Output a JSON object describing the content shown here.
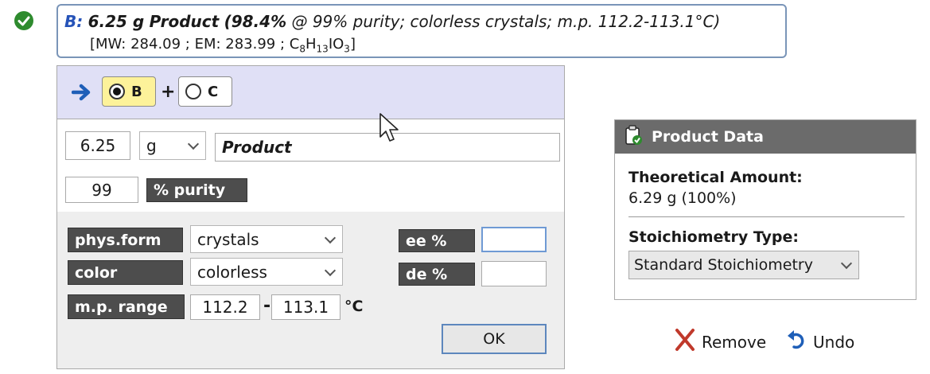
{
  "summary": {
    "tag": "B:",
    "amount": "6.25 g",
    "name": "Product",
    "yield": "(98.4%",
    "details": "@ 99% purity; colorless crystals; m.p. 112.2-113.1°C)",
    "mw_line": "[MW: 284.09 ; EM: 283.99 ; ",
    "formula": {
      "c": "C",
      "c_n": "8",
      "h": "H",
      "h_n": "13",
      "rest": "IO",
      "o_n": "3"
    },
    "close": "]"
  },
  "selector": {
    "options": [
      {
        "label": "B",
        "selected": true
      },
      {
        "label": "C",
        "selected": false
      }
    ],
    "plus": "+"
  },
  "amount": {
    "value": "6.25",
    "unit": "g",
    "name": "Product"
  },
  "purity": {
    "value": "99",
    "label": "% purity"
  },
  "properties": {
    "phys_form_label": "phys.form",
    "phys_form_value": "crystals",
    "color_label": "color",
    "color_value": "colorless",
    "mp_label": "m.p. range",
    "mp_low": "112.2",
    "mp_sep": "-",
    "mp_high": "113.1",
    "mp_unit": "°C",
    "ee_label": "ee %",
    "ee_value": "",
    "de_label": "de %",
    "de_value": ""
  },
  "ok_label": "OK",
  "product_data": {
    "title": "Product Data",
    "theoretical_label": "Theoretical Amount:",
    "theoretical_value": "6.29 g (100%)",
    "stoich_label": "Stoichiometry Type:",
    "stoich_value": "Standard Stoichiometry"
  },
  "actions": {
    "remove": "Remove",
    "undo": "Undo"
  },
  "colors": {
    "accent_blue": "#2653b8",
    "selected_yellow": "#fdf29a",
    "header_lavender": "#e0e0f6",
    "label_dark": "#4d4d4d",
    "remove_red": "#c0392b",
    "check_green": "#2e8b2e"
  },
  "icons": [
    "check-icon",
    "arrow-right-icon",
    "clipboard-check-icon",
    "remove-x-icon",
    "undo-icon",
    "chevron-down-icon"
  ]
}
